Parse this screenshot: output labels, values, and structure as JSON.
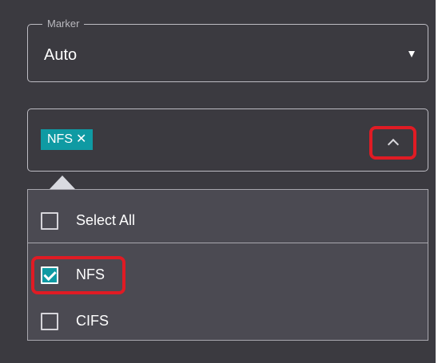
{
  "marker": {
    "label": "Marker",
    "value": "Auto"
  },
  "tag_select": {
    "chips": [
      {
        "label": "NFS",
        "remove_glyph": "✕"
      }
    ]
  },
  "dropdown": {
    "options": [
      {
        "label": "Select All",
        "checked": false
      },
      {
        "label": "NFS",
        "checked": true
      },
      {
        "label": "CIFS",
        "checked": false
      }
    ]
  },
  "colors": {
    "panel_bg": "#3b3a40",
    "dropdown_bg": "#4b4a52",
    "accent": "#0f9aa3",
    "highlight": "#e01b24"
  },
  "icons": {
    "marker_caret": "caret-down-icon",
    "collapse": "chevron-up-icon",
    "chip_remove": "close-icon",
    "check": "checkmark-icon"
  }
}
